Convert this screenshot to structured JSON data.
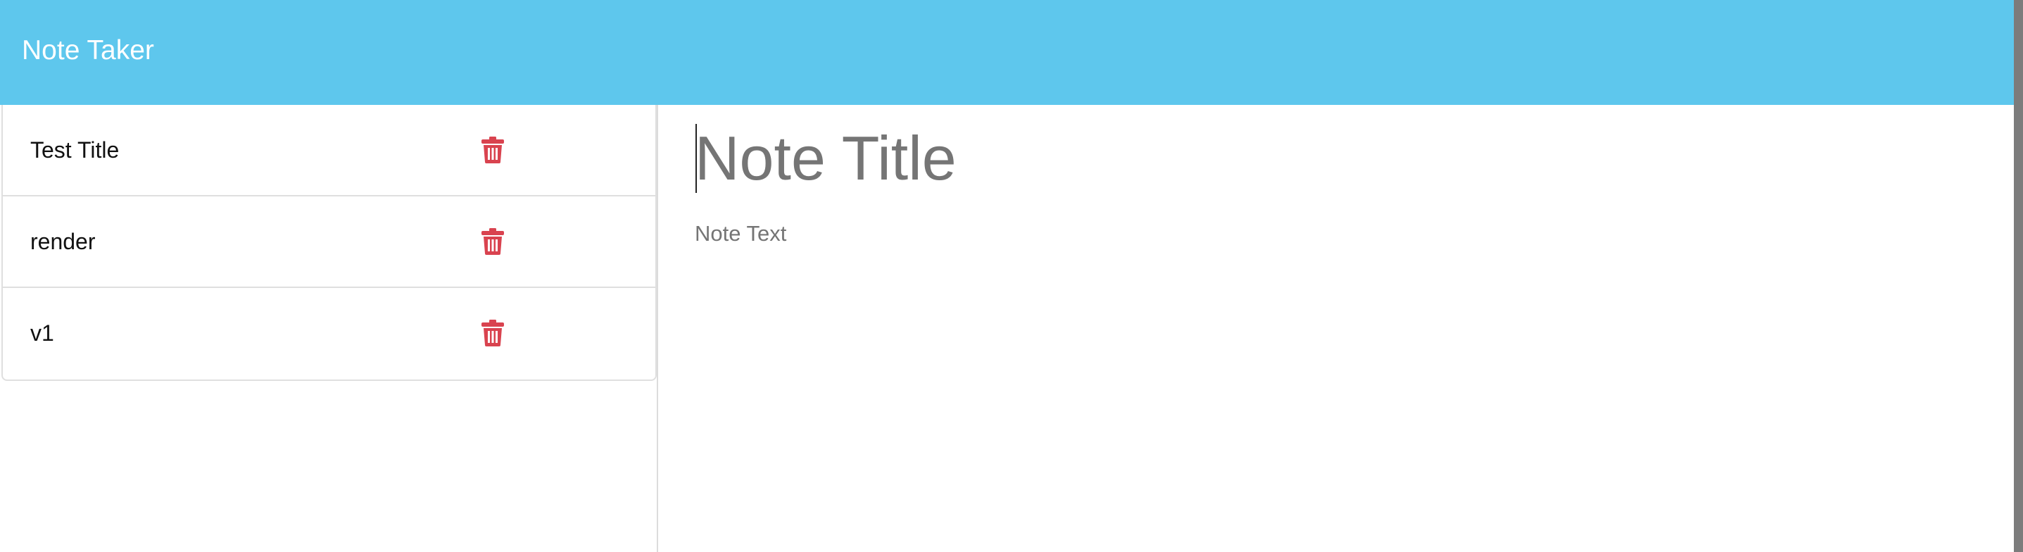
{
  "navbar": {
    "brand": "Note Taker",
    "color": "#5ec7ed"
  },
  "notes": [
    {
      "title": "Test Title",
      "delete_icon": "trash-icon"
    },
    {
      "title": "render",
      "delete_icon": "trash-icon"
    },
    {
      "title": "v1",
      "delete_icon": "trash-icon"
    }
  ],
  "editor": {
    "title_placeholder": "Note Title",
    "text_placeholder": "Note Text"
  },
  "colors": {
    "delete": "#d9434f"
  }
}
